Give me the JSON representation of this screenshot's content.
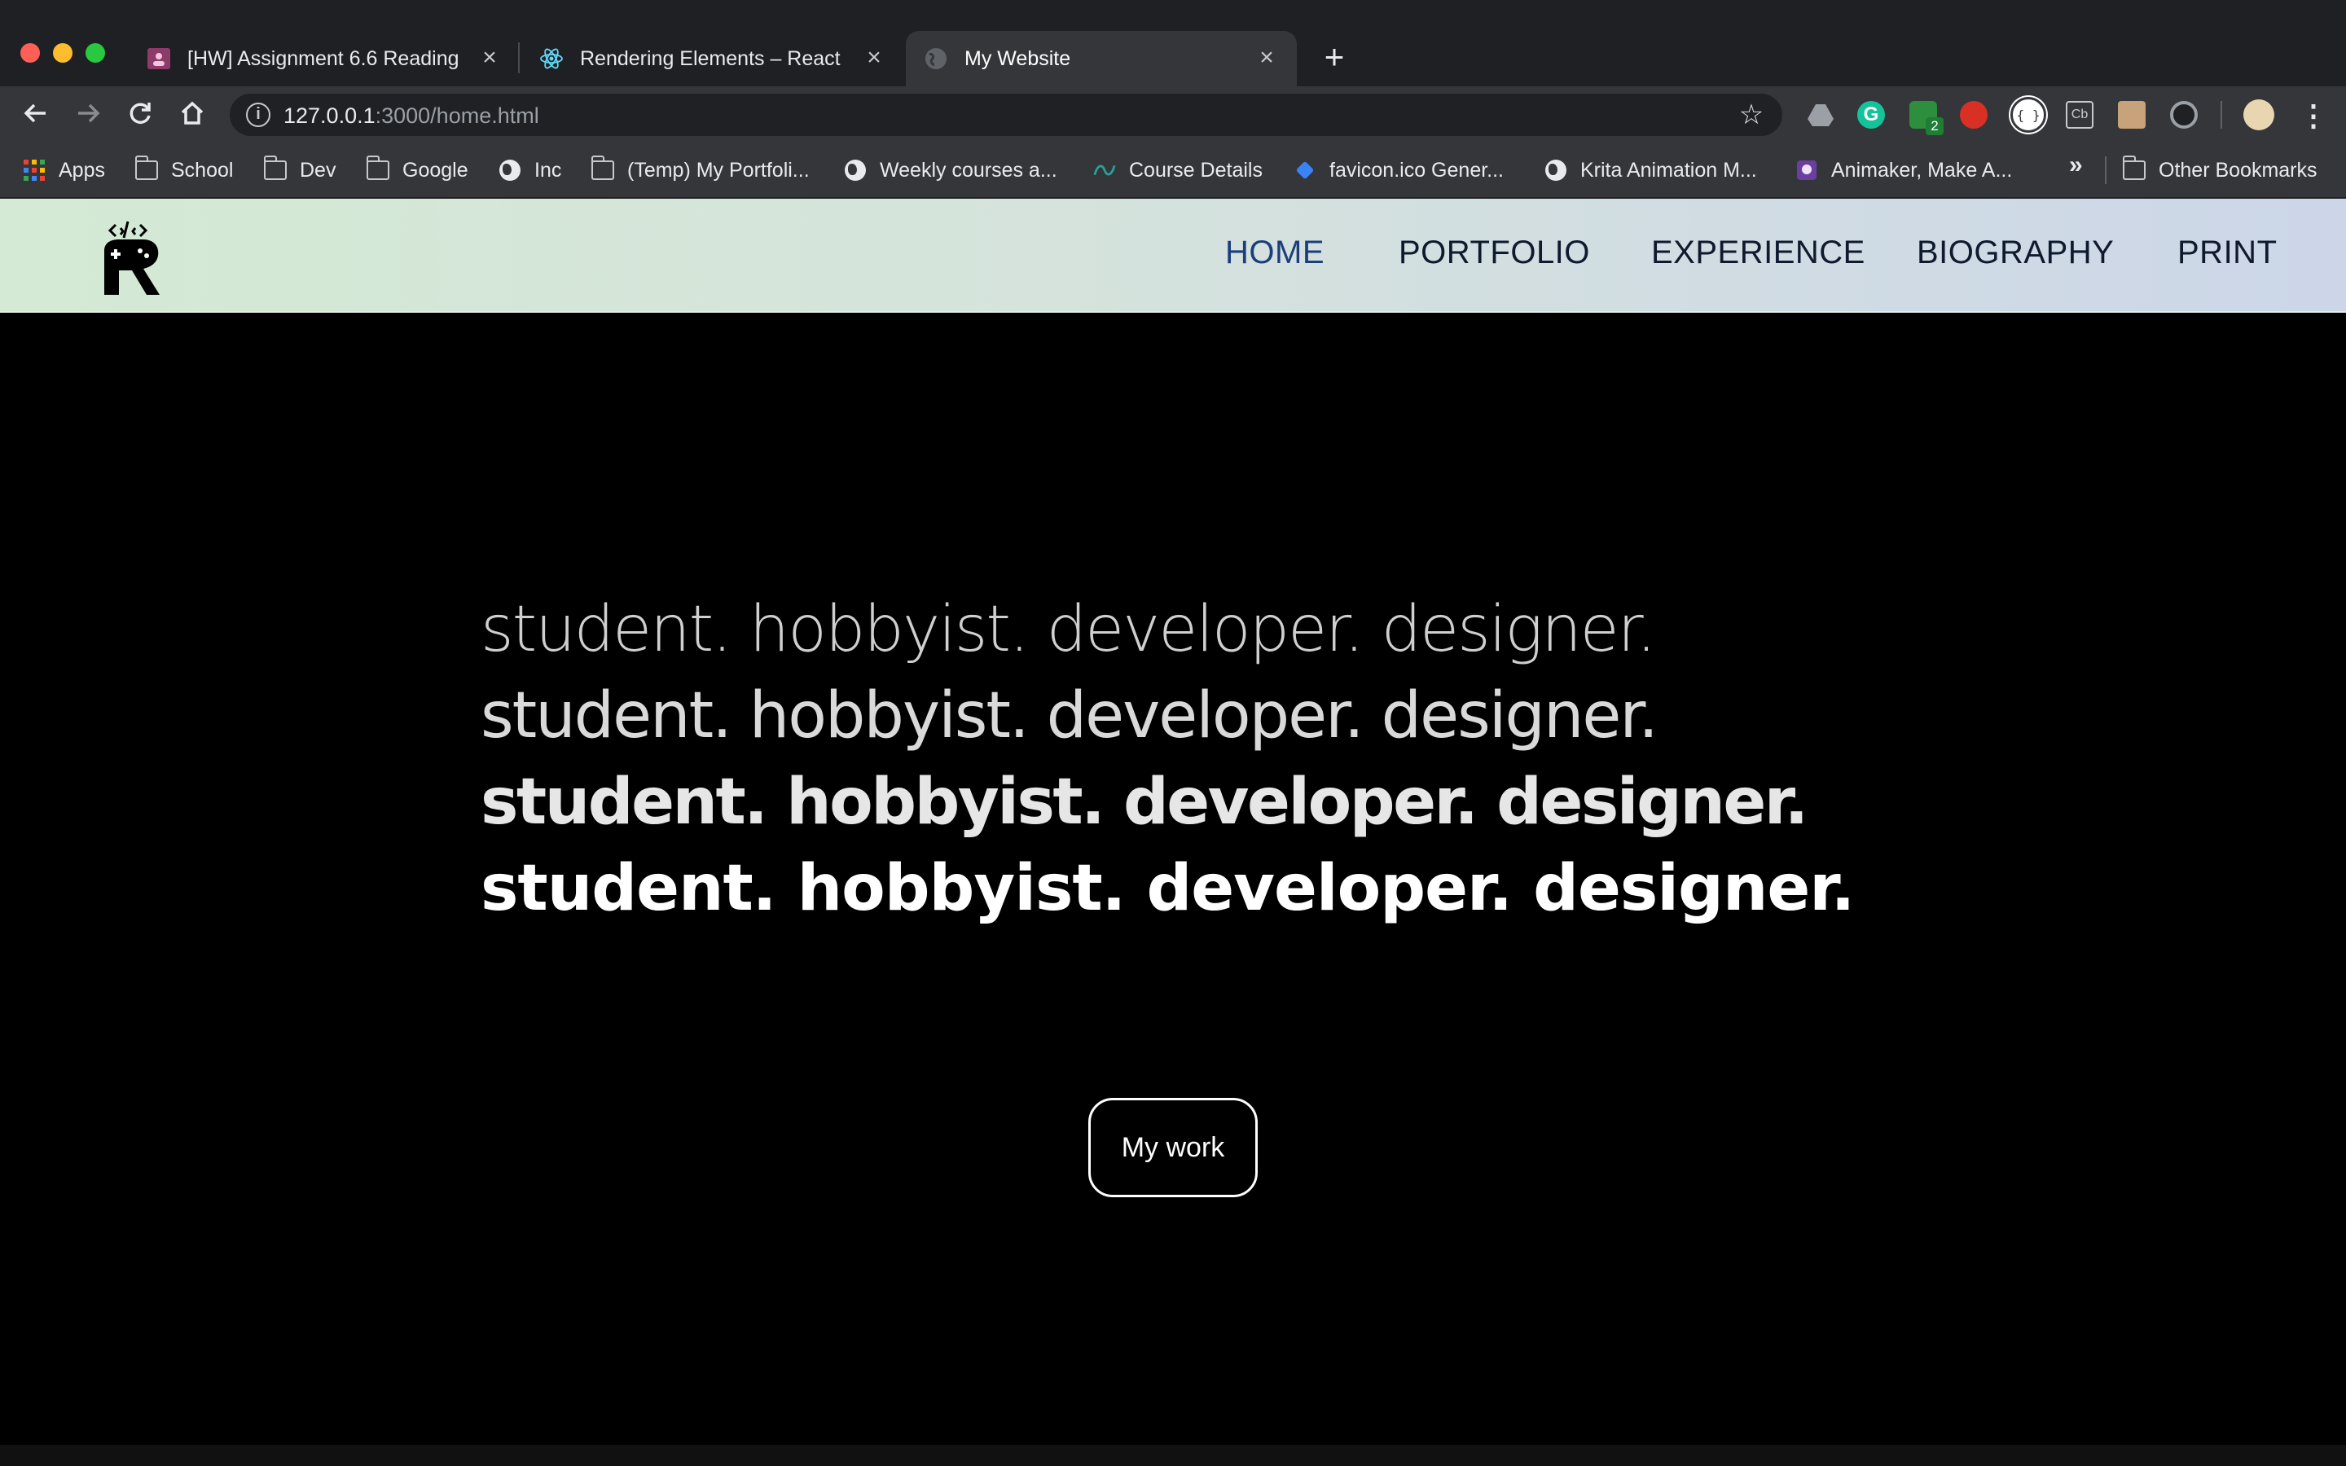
{
  "browser": {
    "tabs": [
      {
        "title": "[HW] Assignment 6.6 Reading",
        "favicon": "classroom-icon",
        "active": false
      },
      {
        "title": "Rendering Elements – React",
        "favicon": "react-icon",
        "active": false
      },
      {
        "title": "My Website",
        "favicon": "globe-icon",
        "active": true
      }
    ],
    "address": {
      "host": "127.0.0.1",
      "rest": ":3000/home.html"
    },
    "bookmarks": [
      {
        "label": "Apps",
        "icon": "apps-grid-icon"
      },
      {
        "label": "School",
        "icon": "folder-icon"
      },
      {
        "label": "Dev",
        "icon": "folder-icon"
      },
      {
        "label": "Google",
        "icon": "folder-icon"
      },
      {
        "label": "Inc",
        "icon": "globe-icon"
      },
      {
        "label": "(Temp) My Portfoli...",
        "icon": "folder-icon"
      },
      {
        "label": "Weekly courses a...",
        "icon": "globe-icon"
      },
      {
        "label": "Course Details",
        "icon": "course-icon"
      },
      {
        "label": "favicon.ico Gener...",
        "icon": "favicon-gen-icon"
      },
      {
        "label": "Krita Animation M...",
        "icon": "globe-icon"
      },
      {
        "label": "Animaker, Make A...",
        "icon": "animaker-icon"
      }
    ],
    "bookmarks_overflow": "»",
    "other_bookmarks": "Other Bookmarks",
    "extension_badge": "2"
  },
  "site": {
    "nav": [
      {
        "label": "HOME",
        "active": true
      },
      {
        "label": "PORTFOLIO",
        "active": false
      },
      {
        "label": "EXPERIENCE",
        "active": false
      },
      {
        "label": "BIOGRAPHY",
        "active": false
      },
      {
        "label": "PRINT",
        "active": false
      }
    ],
    "hero_lines": [
      "student. hobbyist. developer. designer.",
      "student. hobbyist. developer. designer.",
      "student. hobbyist. developer. designer.",
      "student. hobbyist. developer. designer."
    ],
    "cta_label": "My work"
  },
  "colors": {
    "page_background": "#000000",
    "nav_active": "#1c3f7c",
    "nav_text": "#0f1a2e",
    "cta_border": "#ffffff"
  }
}
